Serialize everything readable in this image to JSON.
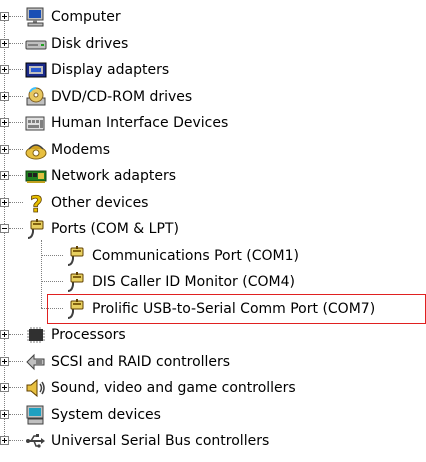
{
  "tree": {
    "items": [
      {
        "label": "Computer",
        "icon": "computer-icon"
      },
      {
        "label": "Disk drives",
        "icon": "disk-drive-icon"
      },
      {
        "label": "Display adapters",
        "icon": "display-adapter-icon"
      },
      {
        "label": "DVD/CD-ROM drives",
        "icon": "cdrom-icon"
      },
      {
        "label": "Human Interface Devices",
        "icon": "hid-icon"
      },
      {
        "label": "Modems",
        "icon": "modem-icon"
      },
      {
        "label": "Network adapters",
        "icon": "network-adapter-icon"
      },
      {
        "label": "Other devices",
        "icon": "unknown-device-icon"
      },
      {
        "label": "Ports (COM & LPT)",
        "icon": "port-icon",
        "expanded": true,
        "children": [
          {
            "label": "Communications Port (COM1)",
            "icon": "port-icon"
          },
          {
            "label": "DIS Caller ID Monitor (COM4)",
            "icon": "port-icon"
          },
          {
            "label": "Prolific USB-to-Serial Comm Port (COM7)",
            "icon": "port-icon",
            "highlighted": true
          }
        ]
      },
      {
        "label": "Processors",
        "icon": "processor-icon"
      },
      {
        "label": "SCSI and RAID controllers",
        "icon": "scsi-icon"
      },
      {
        "label": "Sound, video and game controllers",
        "icon": "sound-icon"
      },
      {
        "label": "System devices",
        "icon": "system-device-icon"
      },
      {
        "label": "Universal Serial Bus controllers",
        "icon": "usb-icon"
      }
    ]
  },
  "colors": {
    "highlight_border": "#e02020",
    "tree_lines": "#808080"
  }
}
